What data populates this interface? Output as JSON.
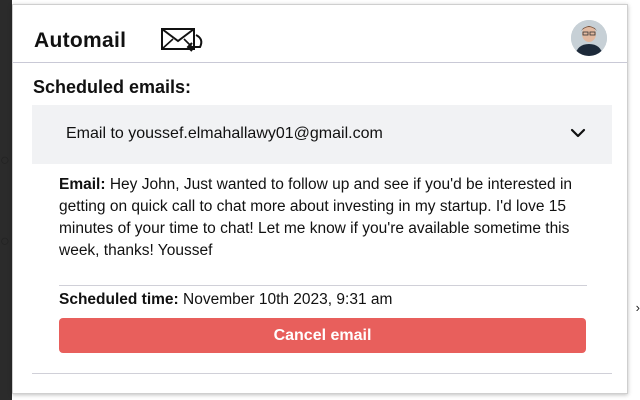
{
  "app": {
    "title": "Automail",
    "logo_icon": "mail-arrow-icon"
  },
  "section": {
    "title": "Scheduled emails:"
  },
  "scheduled_email": {
    "selected_label": "Email to youssef.elmahallawy01@gmail.com",
    "body_label": "Email:",
    "body_text": " Hey John, Just wanted to follow up and see if you'd be interested in getting on quick call to chat more about investing in my startup. I'd love 15 minutes of your time to chat! Let me know if you're available sometime this week, thanks! Youssef",
    "time_label": "Scheduled time:",
    "time_value": " November 10th 2023, 9:31 am"
  },
  "actions": {
    "cancel_label": "Cancel email"
  },
  "colors": {
    "cancel_button": "#e85f5c",
    "dropdown_bg": "#f1f2f4"
  }
}
